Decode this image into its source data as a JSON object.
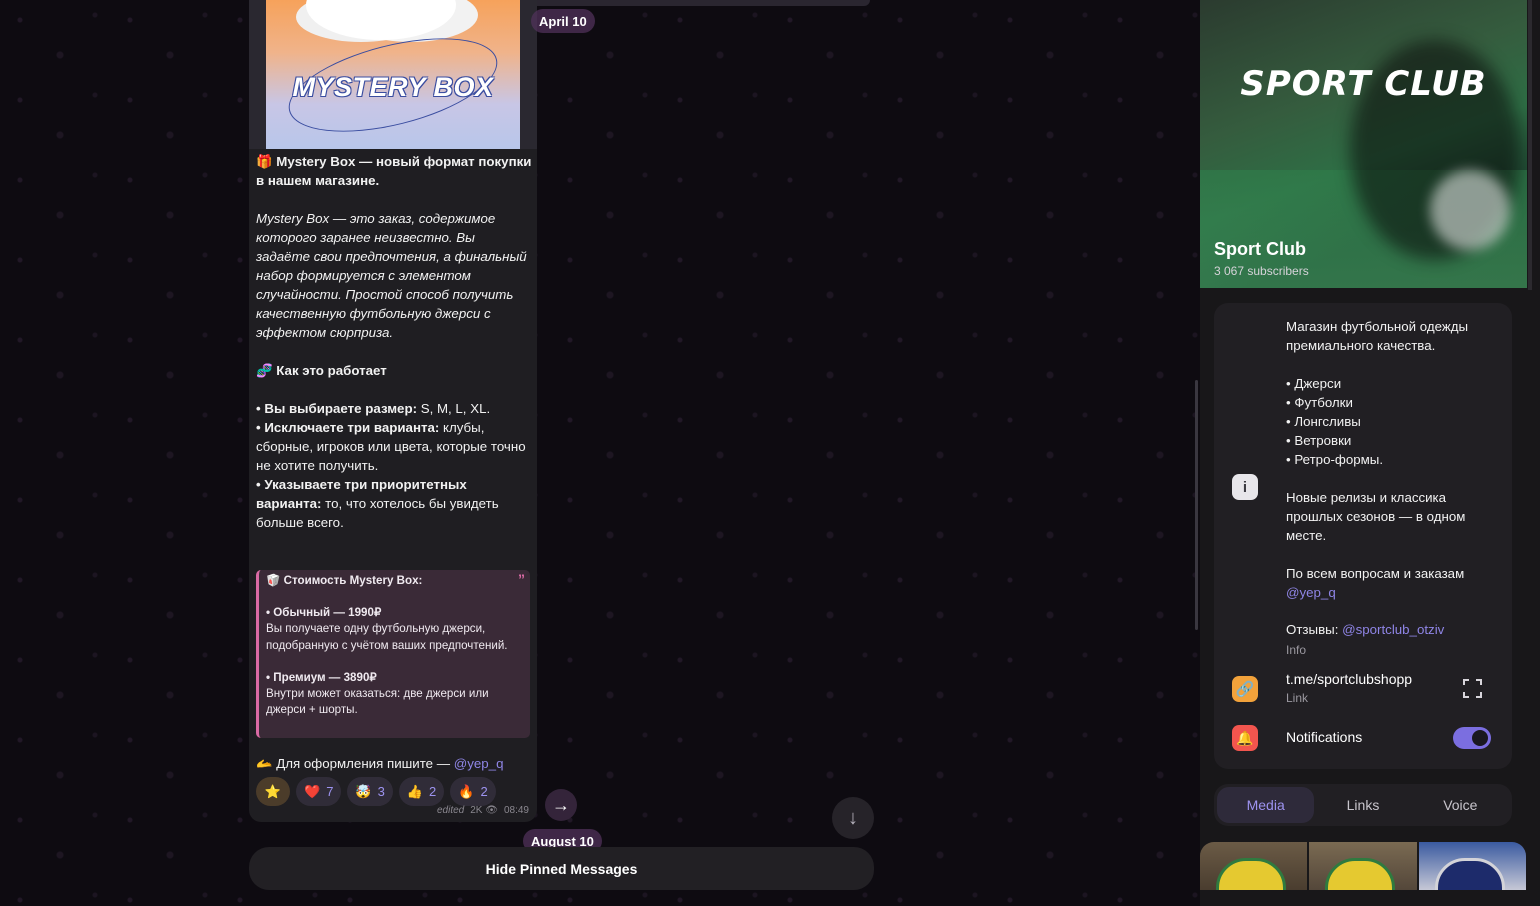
{
  "chat": {
    "date_top": "April 10",
    "date_bottom": "August 10",
    "hide_pinned_label": "Hide Pinned Messages",
    "message": {
      "image_title": "MYSTERY BOX",
      "line1_emoji": "🎁",
      "line1": "Mystery Box — новый формат покупки в нашем магазине.",
      "italic_para": "Mystery Box — это заказ, содержимое которого заранее неизвестно. Вы задаёте свои предпочтения, а финальный набор формируется с элементом случайности. Простой способ получить качественную футбольную джерси с эффектом сюрприза.",
      "how_emoji": "🧬",
      "how_title": "Как это работает",
      "step1_bold": "• Вы выбираете размер:",
      "step1_rest": " S, M, L, XL.",
      "step2_bold": "• Исключаете три варианта:",
      "step2_rest": " клубы, сборные, игроков или цвета, которые точно не хотите получить.",
      "step3_bold": "• Указываете три приоритетных варианта:",
      "step3_rest": " то, что хотелось бы увидеть больше всего.",
      "quote": {
        "title": "🥡 Стоимость Mystery Box:",
        "tier1_title": "• Обычный — 1990₽",
        "tier1_desc": "Вы получаете одну футбольную джерси, подобранную с учётом ваших предпочтений.",
        "tier2_title": "• Премиум — 3890₽",
        "tier2_desc": "Внутри может оказаться: две джерси или джерси + шорты.",
        "quote_mark": "”"
      },
      "contact_prefix": "🫴 Для оформления пишите — ",
      "contact_handle": "@yep_q",
      "reactions": [
        {
          "emoji": "⭐",
          "count": ""
        },
        {
          "emoji": "❤️",
          "count": "7"
        },
        {
          "emoji": "🤯",
          "count": "3"
        },
        {
          "emoji": "👍",
          "count": "2"
        },
        {
          "emoji": "🔥",
          "count": "2"
        }
      ],
      "edited_label": "edited",
      "views": "2K",
      "time": "08:49"
    }
  },
  "channel": {
    "brand": "SPORT CLUB",
    "title": "Sport Club",
    "subscribers": "3 067 subscribers",
    "desc1": "Магазин футбольной одежды премиального качества.",
    "list": [
      "• Джерси",
      "• Футболки",
      "• Лонгсливы",
      "• Ветровки",
      "• Ретро-формы."
    ],
    "desc2": "Новые релизы и классика прошлых сезонов — в одном месте.",
    "desc3_prefix": "По всем вопросам и заказам",
    "desc3_handle": "@yep_q",
    "reviews_prefix": "Отзывы: ",
    "reviews_handle": "@sportclub_otziv",
    "info_label": "Info",
    "link": "t.me/sportclubshopp",
    "link_label": "Link",
    "notifications_label": "Notifications",
    "notifications_on": true,
    "tabs": [
      "Media",
      "Links",
      "Voice"
    ],
    "active_tab": "Media"
  },
  "colors": {
    "accent": "#9d93f0",
    "bubble": "#1f1e22",
    "quote_border": "#d96aa4",
    "toggle": "#7b6ee0"
  }
}
